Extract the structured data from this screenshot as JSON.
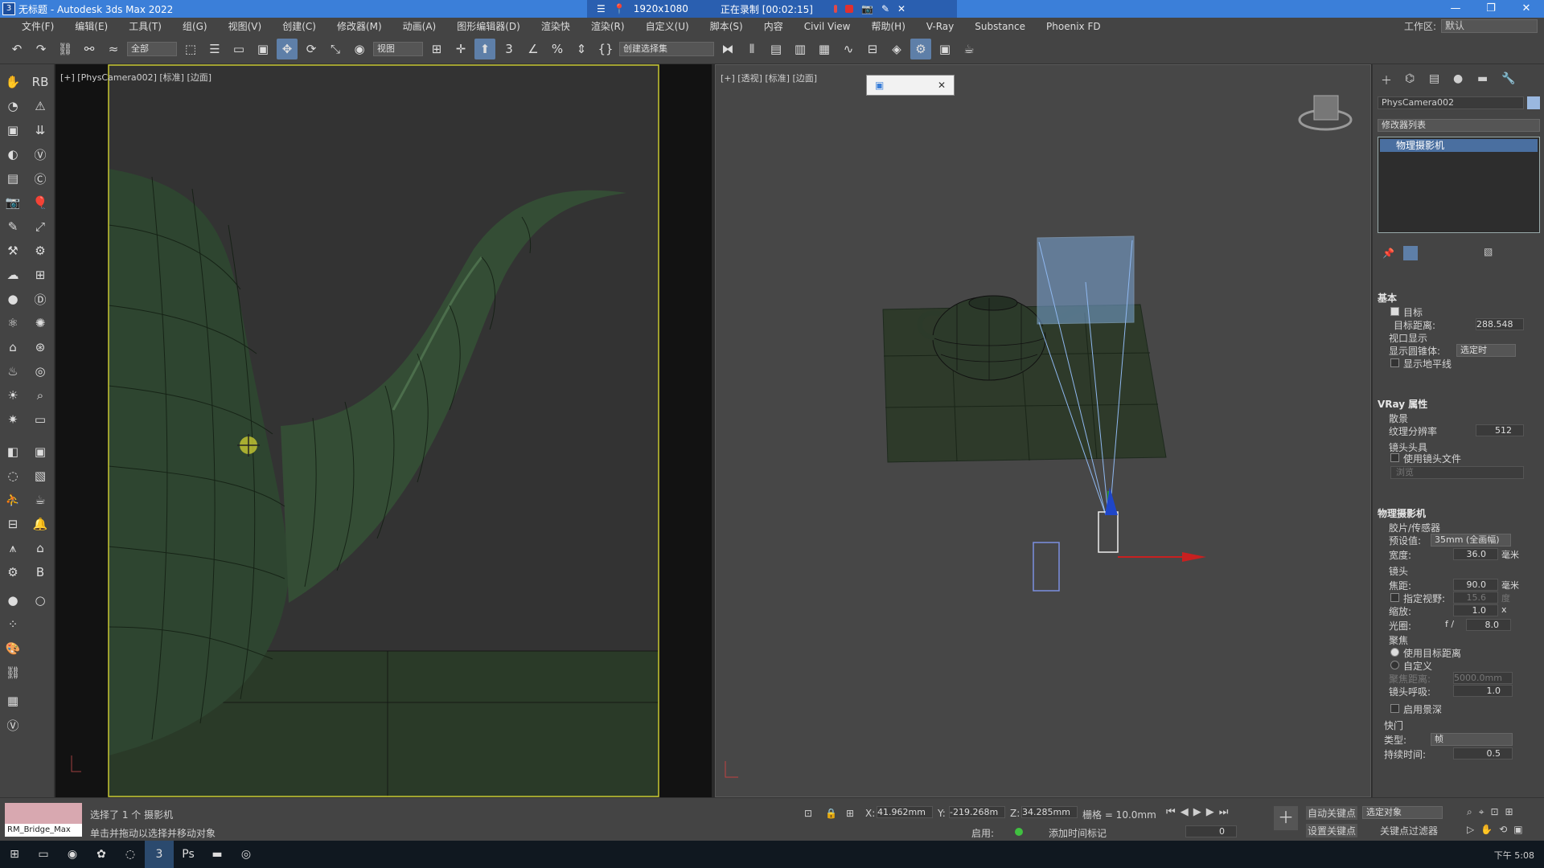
{
  "titlebar": {
    "title": "无标题 - Autodesk 3ds Max 2022",
    "app_icon": "3"
  },
  "recorder": {
    "resolution": "1920x1080",
    "status": "正在录制 [00:02:15]"
  },
  "menu": [
    "文件(F)",
    "编辑(E)",
    "工具(T)",
    "组(G)",
    "视图(V)",
    "创建(C)",
    "修改器(M)",
    "动画(A)",
    "图形编辑器(D)",
    "渲染快",
    "渲染(R)",
    "自定义(U)",
    "脚本(S)",
    "内容",
    "Civil View",
    "帮助(H)",
    "V-Ray",
    "Substance",
    "Phoenix FD"
  ],
  "workspace": {
    "label": "工作区:",
    "value": "默认"
  },
  "toolbar": {
    "filter": "全部",
    "refcoord": "视图",
    "selset": "创建选择集"
  },
  "viewport1": {
    "label": "[+] [PhysCamera002] [标准] [边面]"
  },
  "viewport2": {
    "label": "[+] [透视] [标准] [边面]"
  },
  "right_panel": {
    "object_name": "PhysCamera002",
    "modifier_list": "修改器列表",
    "stack_item": "物理摄影机",
    "basic": {
      "title": "基本",
      "target": "目标",
      "target_dist_label": "目标距离:",
      "target_dist": "288.548",
      "viewport_display": "视口显示",
      "show_cone_label": "显示圆锥体:",
      "show_cone": "选定时",
      "show_horizon": "显示地平线"
    },
    "vray": {
      "title": "VRay 属性",
      "scatter": "散景",
      "tex_res_label": "纹理分辨率",
      "tex_res": "512",
      "lens_head": "镜头头具",
      "use_lens_file": "使用镜头文件",
      "browse": "浏览"
    },
    "physcam": {
      "title": "物理摄影机",
      "film": "胶片/传感器",
      "preset_label": "预设值:",
      "preset": "35mm (全画幅)",
      "width_label": "宽度:",
      "width": "36.0",
      "width_unit": "毫米",
      "lens": "镜头",
      "focal_label": "焦距:",
      "focal": "90.0",
      "focal_unit": "毫米",
      "fov_label": "指定视野:",
      "fov": "15.6",
      "fov_unit": "度",
      "zoom_label": "缩放:",
      "zoom": "1.0",
      "zoom_unit": "x",
      "aperture_label": "光圈:",
      "aperture_f": "f /",
      "aperture": "8.0",
      "focus": "聚焦",
      "use_target": "使用目标距离",
      "custom": "自定义",
      "focus_dist_label": "聚焦距离:",
      "focus_dist": "5000.0mm",
      "breathing_label": "镜头呼吸:",
      "breathing": "1.0",
      "enable_dof": "启用景深",
      "shutter": "快门",
      "type_label": "类型:",
      "type": "帧",
      "duration_label": "持续时间:",
      "duration": "0.5"
    }
  },
  "status": {
    "maxscript": "RM_Bridge_Max",
    "selected": "选择了 1 个 摄影机",
    "hint": "单击并拖动以选择并移动对象",
    "x_label": "X:",
    "x": "41.962mm",
    "y_label": "Y:",
    "y": "-219.268m",
    "z_label": "Z:",
    "z": "34.285mm",
    "grid": "栅格 = 10.0mm",
    "enable": "启用:",
    "add_time_tag": "添加时间标记",
    "auto_key": "自动关键点",
    "set_key": "设置关键点",
    "key_mode": "选定对象",
    "key_filter": "关键点过滤器",
    "frame": "0"
  },
  "taskbar": {
    "time": "下午 5:08"
  },
  "colors": {
    "accent": "#3b7fd9",
    "active": "#5e7fa8",
    "mesh": "#2e4530",
    "selected_frame": "#c8c832"
  }
}
